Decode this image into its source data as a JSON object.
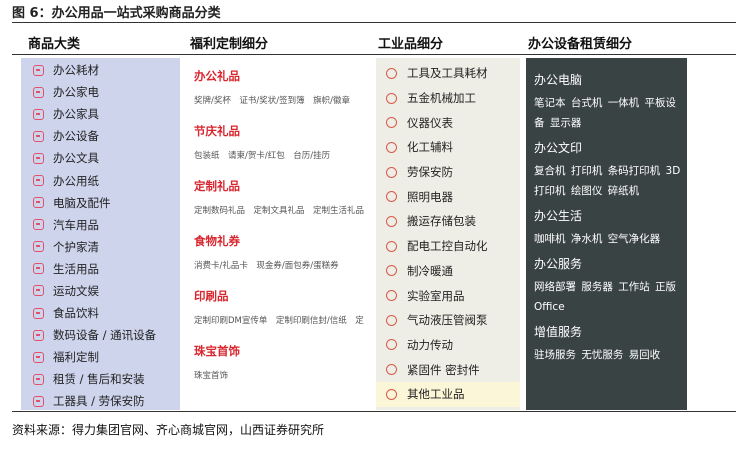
{
  "figure_title": "图 6：办公用品一站式采购商品分类",
  "columns": {
    "c1": "商品大类",
    "c2": "福利定制细分",
    "c3": "工业品细分",
    "c4": "办公设备租赁细分"
  },
  "categories": [
    "办公耗材",
    "办公家电",
    "办公家具",
    "办公设备",
    "办公文具",
    "办公用纸",
    "电脑及配件",
    "汽车用品",
    "个护家清",
    "生活用品",
    "运动文娱",
    "食品饮料",
    "数码设备 / 通讯设备",
    "福利定制",
    "租赁 / 售后和安装",
    "工器具 / 劳保安防"
  ],
  "welfare_sections": [
    {
      "title": "办公礼品",
      "subs": "奖牌/奖杯　证书/奖状/签到簿　旗帜/徽章"
    },
    {
      "title": "节庆礼品",
      "subs": "包装纸　请柬/贺卡/红包　台历/挂历"
    },
    {
      "title": "定制礼品",
      "subs": "定制数码礼品　定制文具礼品　定制生活礼品"
    },
    {
      "title": "食物礼券",
      "subs": "消费卡/礼品卡　现金券/面包券/蛋糕券"
    },
    {
      "title": "印刷品",
      "subs": "定制印刷DM宣传单　定制印刷信封/信纸　定"
    },
    {
      "title": "珠宝首饰",
      "subs": "珠宝首饰"
    }
  ],
  "industrial_items": [
    "工具及工具耗材",
    "五金机械加工",
    "仪器仪表",
    "化工辅料",
    "劳保安防",
    "照明电器",
    "搬运存储包装",
    "配电工控自动化",
    "制冷暖通",
    "实验室用品",
    "气动液压管阀泵",
    "动力传动",
    "紧固件 密封件",
    "其他工业品"
  ],
  "leasing_groups": [
    {
      "title": "办公电脑",
      "items": [
        "笔记本",
        "台式机",
        "一体机",
        "平板设备",
        "显示器"
      ]
    },
    {
      "title": "办公文印",
      "items": [
        "复合机",
        "打印机",
        "条码打印机",
        "3D打印机",
        "绘图仪",
        "碎纸机"
      ]
    },
    {
      "title": "办公生活",
      "items": [
        "咖啡机",
        "净水机",
        "空气净化器"
      ]
    },
    {
      "title": "办公服务",
      "items": [
        "网络部署",
        "服务器",
        "工作站",
        "正版Office"
      ]
    },
    {
      "title": "增值服务",
      "items": [
        "驻场服务",
        "无忧服务",
        "易回收"
      ]
    }
  ],
  "source": "资料来源：得力集团官网、齐心商城官网，山西证券研究所",
  "colors": {
    "cat_panel": "#cdd4ec",
    "welfare_accent": "#d8262e",
    "industrial_panel": "#efeee6",
    "leasing_panel": "#3a4344"
  }
}
